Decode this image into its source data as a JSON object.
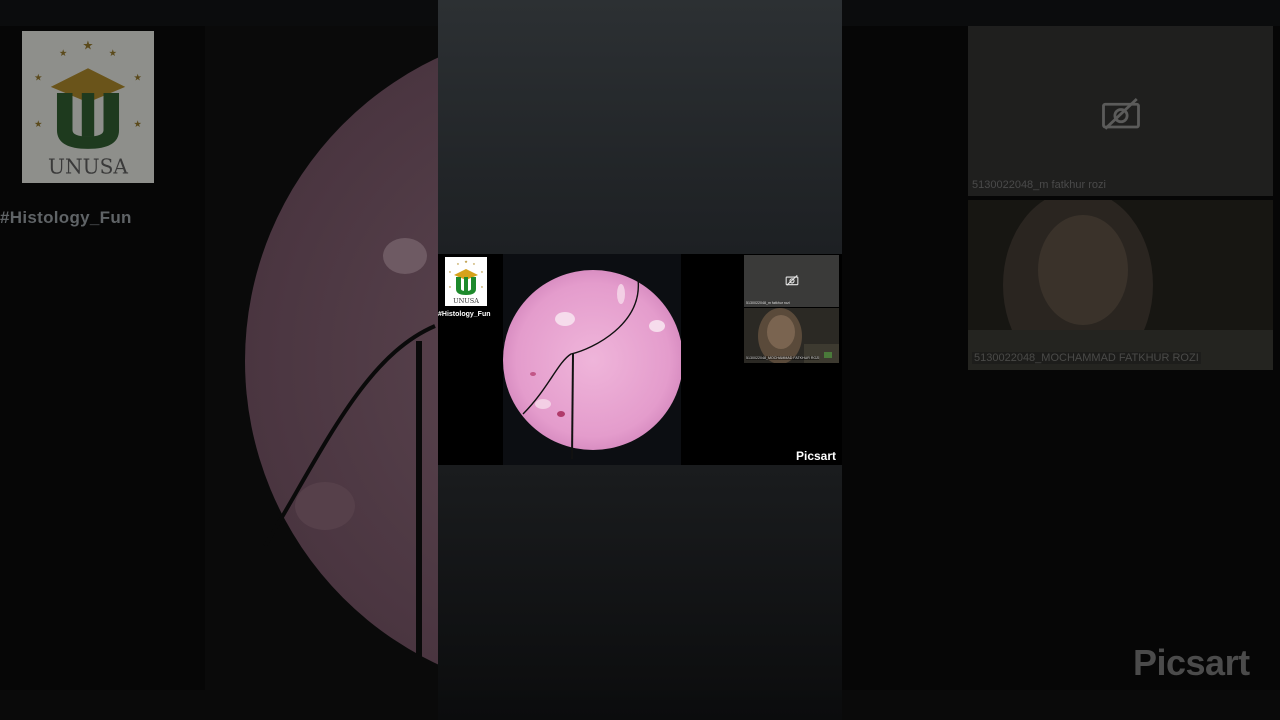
{
  "logo": {
    "text": "UNUSA",
    "icon": "unusa-logo-icon",
    "colors": {
      "gold": "#d6a21b",
      "green": "#1d8a2c",
      "star": "#b08a25"
    }
  },
  "hashtag": "#Histology_Fun",
  "tiles": {
    "camera_off": {
      "icon": "camera-off-icon",
      "name": "5130022048_m fatkhur rozi"
    },
    "video": {
      "name": "5130022048_MOCHAMMAD FATKHUR ROZI"
    }
  },
  "watermark": "Picsart",
  "slide": {
    "icon": "histology-slide-image",
    "stain_color": "#e8a6d2"
  }
}
